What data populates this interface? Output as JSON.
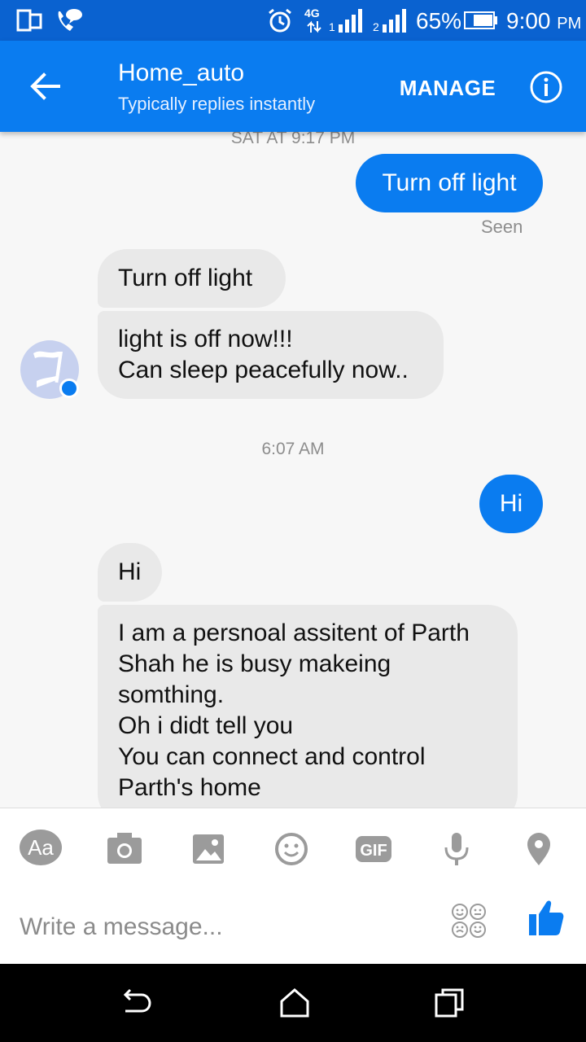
{
  "status_bar": {
    "battery": "65%",
    "time": "9:00",
    "time_suffix": "PM",
    "network": "4G"
  },
  "header": {
    "title": "Home_auto",
    "subtitle": "Typically replies instantly",
    "manage_label": "MANAGE"
  },
  "conversation": {
    "timestamp_1": "SAT AT 9:17 PM",
    "outgoing_1": "Turn off light",
    "seen_label": "Seen",
    "incoming_1": "Turn off light",
    "incoming_2": "light is off now!!!\nCan sleep peacefully now..",
    "timestamp_2": "6:07 AM",
    "outgoing_2": "Hi",
    "incoming_3": "Hi",
    "incoming_4": "I am a persnoal assitent of Parth\nShah he is busy makeing\nsomthing.\nOh i didt tell you\nYou can connect and control\nParth's home"
  },
  "composer": {
    "tools": [
      "text-format-icon",
      "camera-icon",
      "image-icon",
      "emoji-icon",
      "gif-icon",
      "microphone-icon",
      "location-icon"
    ],
    "aa_label": "Aa",
    "gif_label": "GIF",
    "placeholder": "Write a message..."
  },
  "colors": {
    "brand_blue": "#0a7cf0",
    "status_blue": "#0a62d0",
    "incoming_bubble": "#e9e9e9",
    "tool_gray": "#9b9b9b"
  }
}
